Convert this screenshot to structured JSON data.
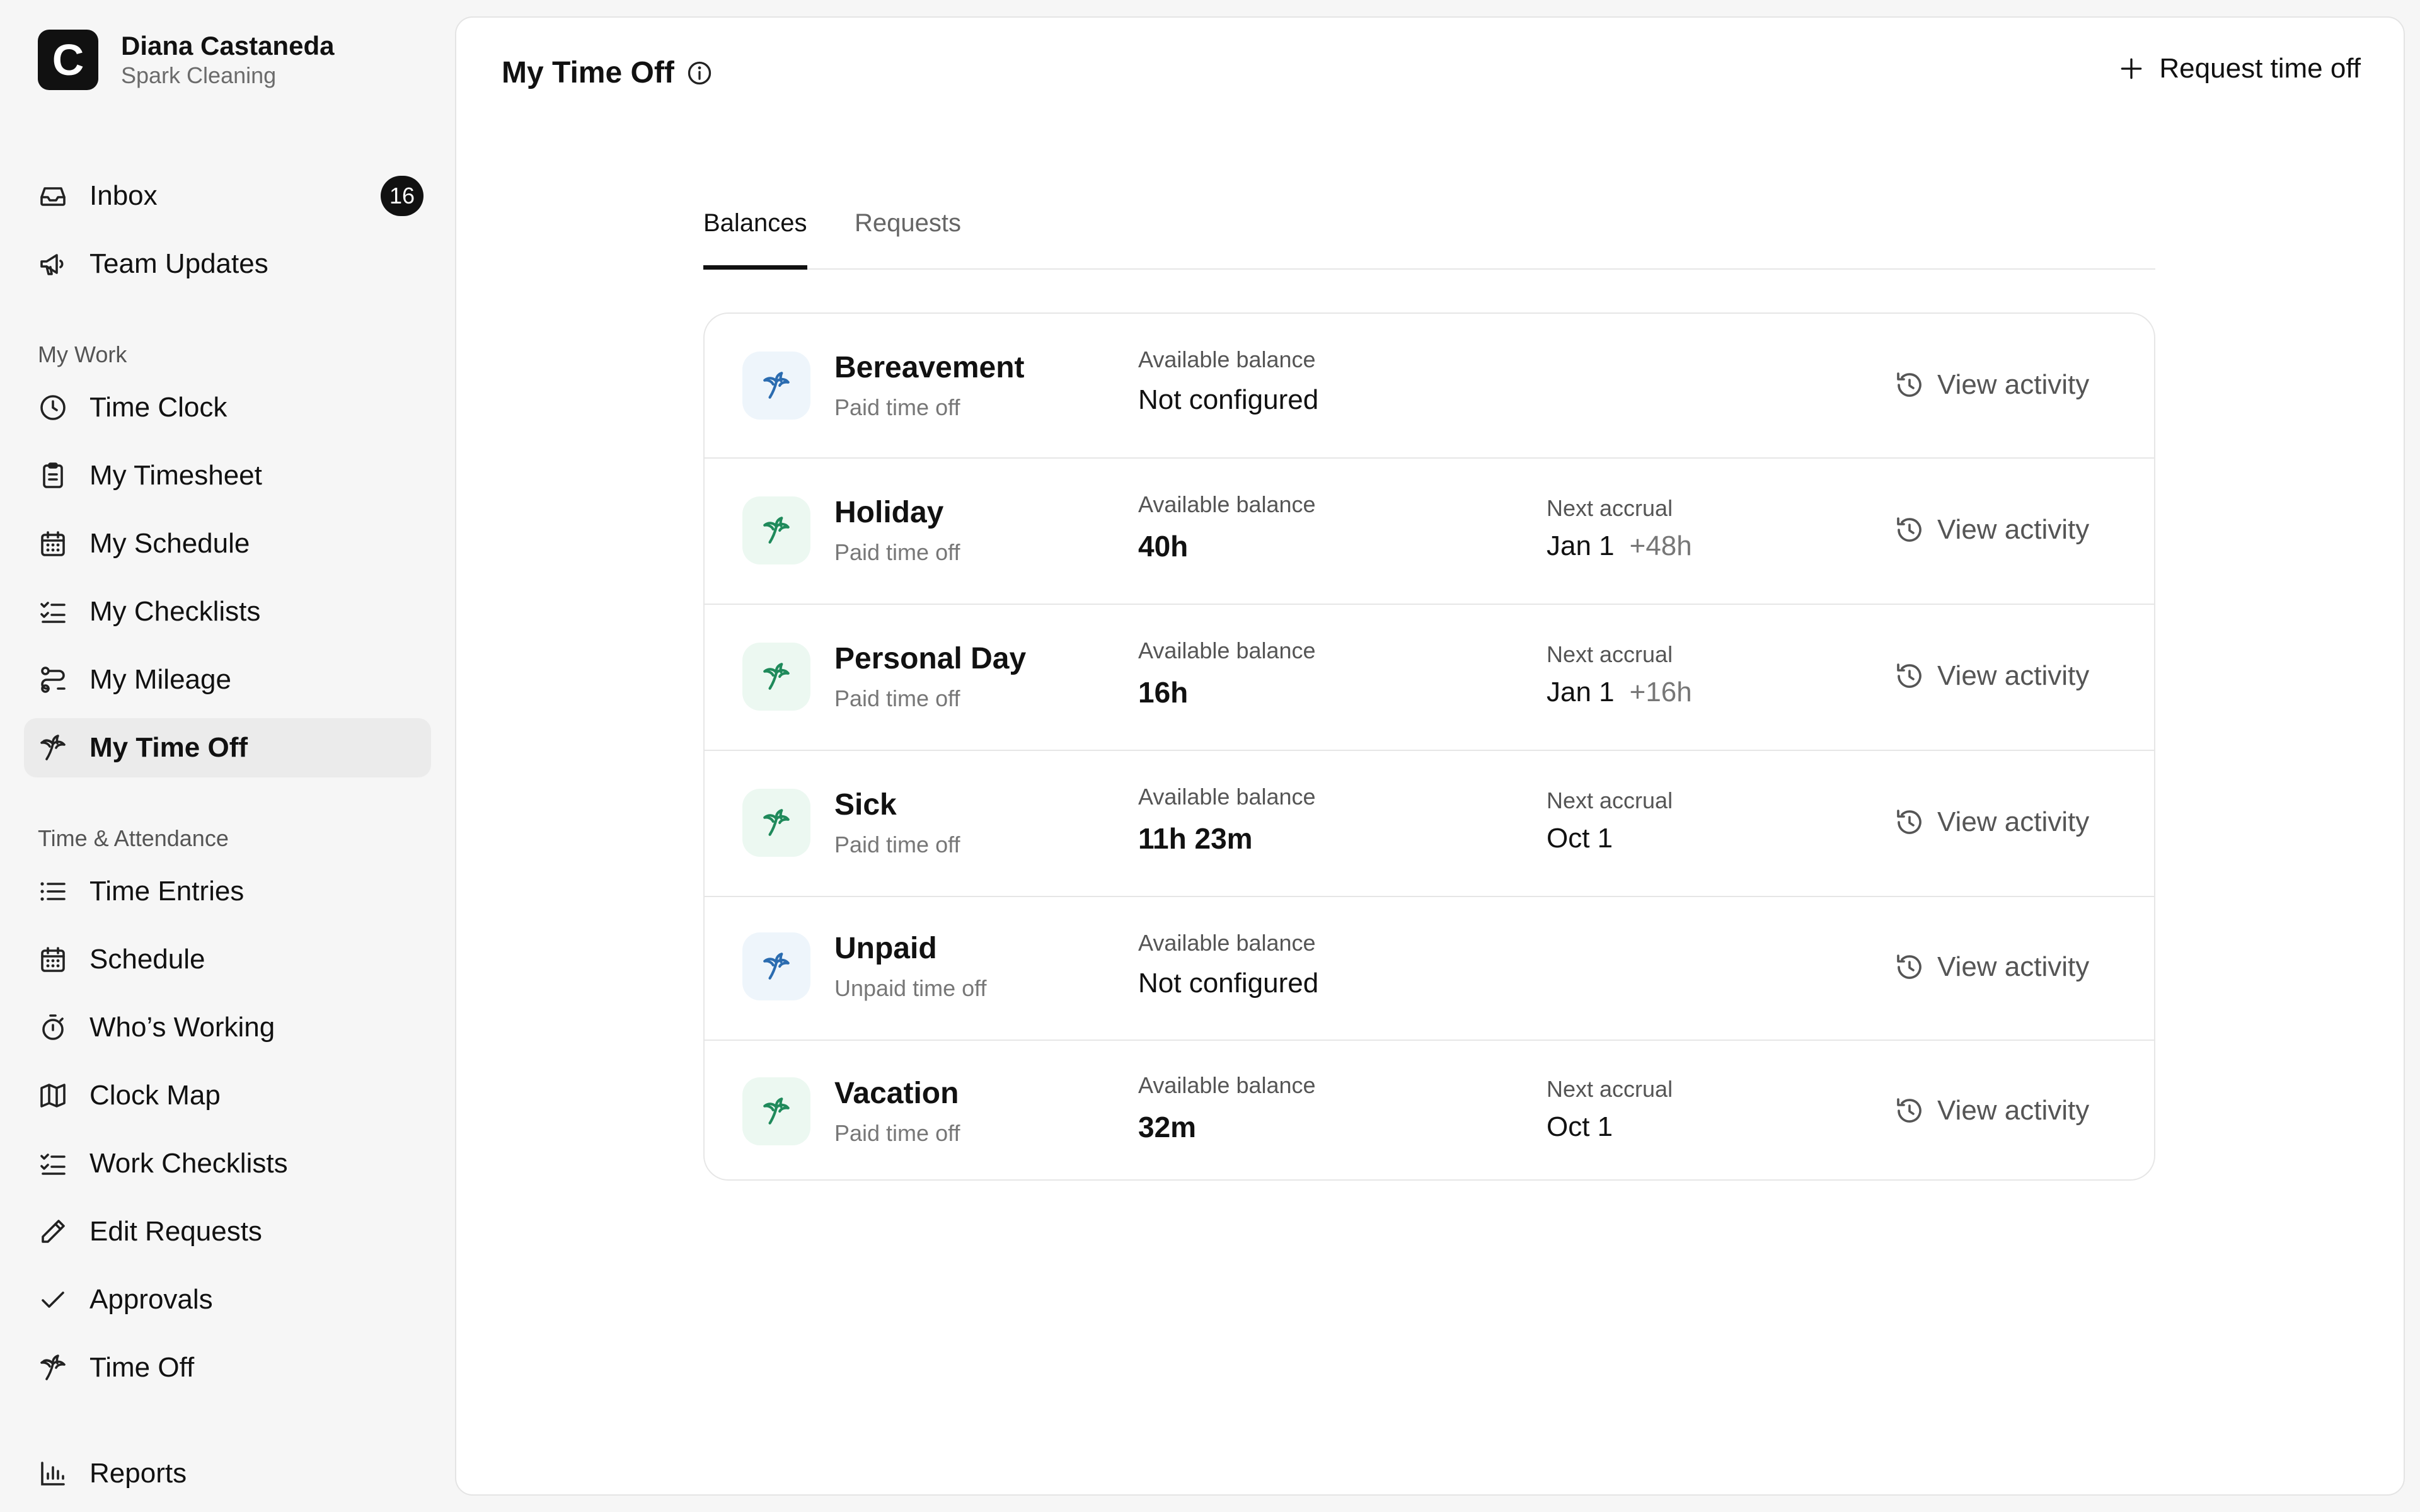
{
  "user": {
    "name": "Diana Castaneda",
    "organization": "Spark Cleaning",
    "logo_letter": "C"
  },
  "nav": {
    "top": [
      {
        "label": "Inbox",
        "icon": "inbox-icon",
        "badge": "16"
      },
      {
        "label": "Team Updates",
        "icon": "megaphone-icon"
      }
    ],
    "my_work_title": "My Work",
    "my_work": [
      {
        "label": "Time Clock",
        "icon": "clock-icon"
      },
      {
        "label": "My Timesheet",
        "icon": "clipboard-icon"
      },
      {
        "label": "My Schedule",
        "icon": "calendar-icon"
      },
      {
        "label": "My Checklists",
        "icon": "checklist-icon"
      },
      {
        "label": "My Mileage",
        "icon": "route-icon"
      },
      {
        "label": "My Time Off",
        "icon": "palm-tree-icon",
        "active": true
      }
    ],
    "time_attendance_title": "Time & Attendance",
    "time_attendance": [
      {
        "label": "Time Entries",
        "icon": "list-icon"
      },
      {
        "label": "Schedule",
        "icon": "calendar-icon"
      },
      {
        "label": "Who’s Working",
        "icon": "stopwatch-icon"
      },
      {
        "label": "Clock Map",
        "icon": "map-icon"
      },
      {
        "label": "Work Checklists",
        "icon": "checklist-icon"
      },
      {
        "label": "Edit Requests",
        "icon": "pencil-icon"
      },
      {
        "label": "Approvals",
        "icon": "check-icon"
      },
      {
        "label": "Time Off",
        "icon": "palm-tree-icon"
      }
    ],
    "bottom": [
      {
        "label": "Reports",
        "icon": "bar-chart-icon"
      }
    ]
  },
  "header": {
    "title": "My Time Off",
    "request_button": "Request time off"
  },
  "tabs": [
    {
      "label": "Balances",
      "active": true
    },
    {
      "label": "Requests",
      "active": false
    }
  ],
  "balances": {
    "available_label": "Available balance",
    "next_accrual_label": "Next accrual",
    "view_activity_label": "View activity",
    "rows": [
      {
        "name": "Bereavement",
        "kind": "Paid time off",
        "balance": "Not configured",
        "icon_color": "#2b6cb0",
        "icon_bg": "#eef5fb",
        "next_accrual": null,
        "accrual_amount": null
      },
      {
        "name": "Holiday",
        "kind": "Paid time off",
        "balance": "40h",
        "icon_color": "#1f8a5b",
        "icon_bg": "#ecf8f1",
        "next_accrual": "Jan 1",
        "accrual_amount": "+48h"
      },
      {
        "name": "Personal Day",
        "kind": "Paid time off",
        "balance": "16h",
        "icon_color": "#1f8a5b",
        "icon_bg": "#ecf8f1",
        "next_accrual": "Jan 1",
        "accrual_amount": "+16h"
      },
      {
        "name": "Sick",
        "kind": "Paid time off",
        "balance": "11h 23m",
        "icon_color": "#1f8a5b",
        "icon_bg": "#ecf8f1",
        "next_accrual": "Oct 1",
        "accrual_amount": null
      },
      {
        "name": "Unpaid",
        "kind": "Unpaid time off",
        "balance": "Not configured",
        "icon_color": "#2b6cb0",
        "icon_bg": "#eef5fb",
        "next_accrual": null,
        "accrual_amount": null
      },
      {
        "name": "Vacation",
        "kind": "Paid time off",
        "balance": "32m",
        "icon_color": "#1f8a5b",
        "icon_bg": "#ecf8f1",
        "next_accrual": "Oct 1",
        "accrual_amount": null
      }
    ]
  }
}
